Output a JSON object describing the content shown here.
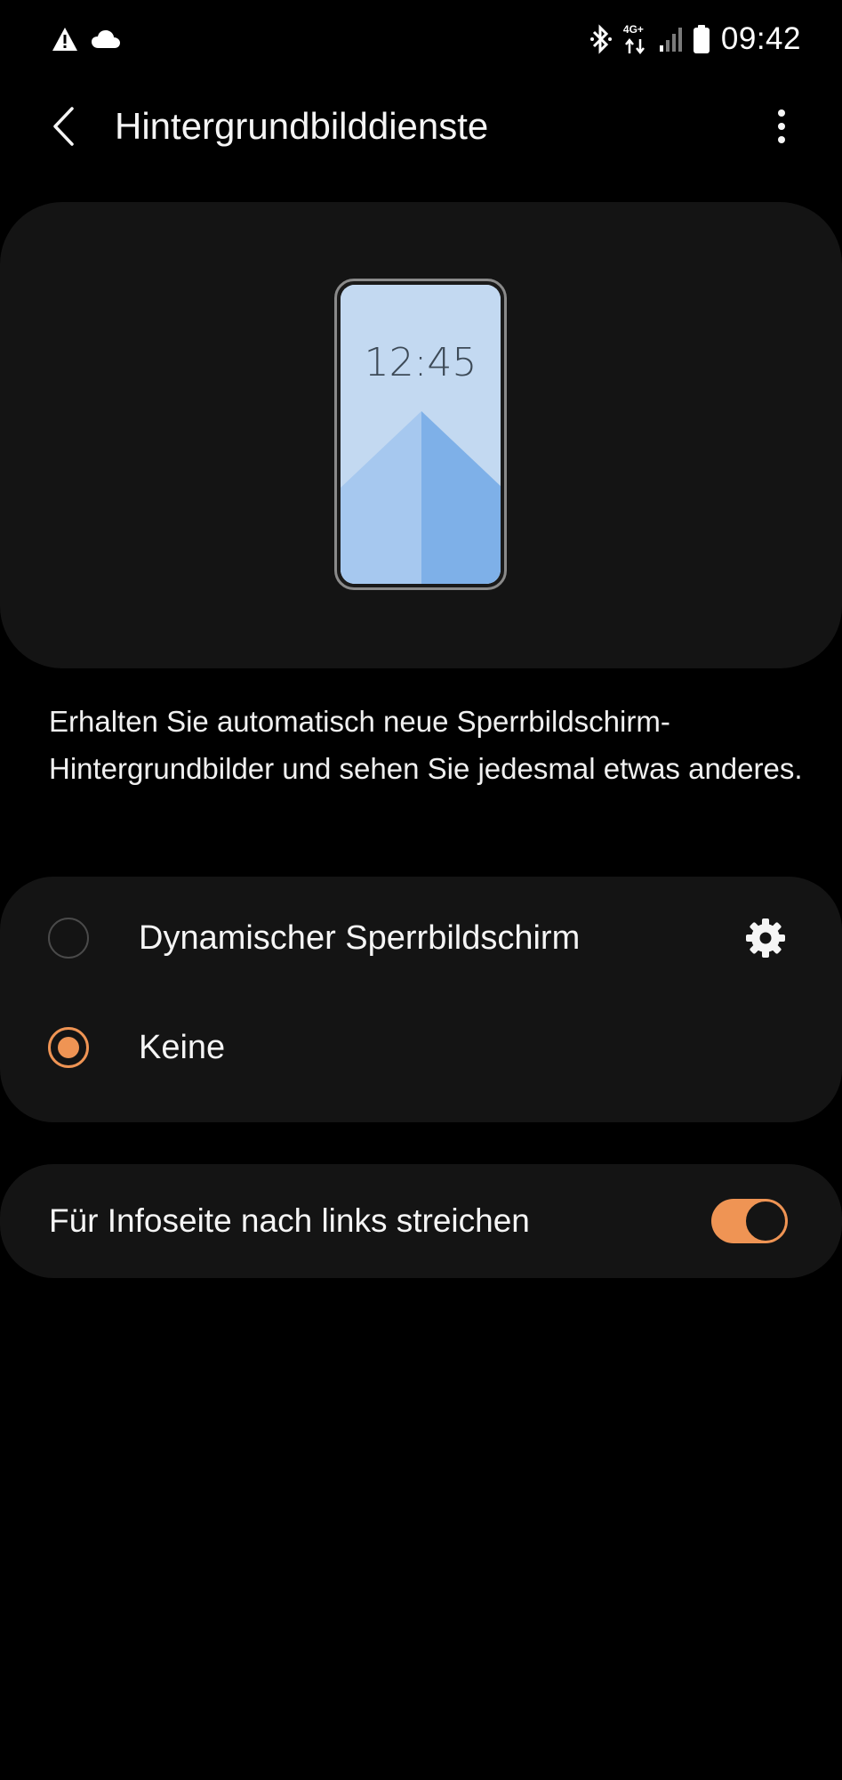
{
  "status_bar": {
    "time": "09:42",
    "network_label": "4G+",
    "left_icons": [
      "warning-icon",
      "cloud-icon"
    ],
    "right_icons": [
      "bluetooth-icon",
      "mobile-data-icon",
      "signal-icon",
      "battery-icon"
    ]
  },
  "header": {
    "title": "Hintergrundbilddienste",
    "back_icon": "chevron-left-icon",
    "more_icon": "more-vertical-icon"
  },
  "preview": {
    "clock": "12:45"
  },
  "description": "Erhalten Sie automatisch neue Sperrbildschirm-Hintergrundbilder und sehen Sie jedesmal etwas anderes.",
  "options": [
    {
      "label": "Dynamischer Sperrbildschirm",
      "selected": false,
      "has_settings": true,
      "settings_icon": "gear-icon"
    },
    {
      "label": "Keine",
      "selected": true,
      "has_settings": false
    }
  ],
  "swipe_setting": {
    "label": "Für Infoseite nach links streichen",
    "enabled": true
  },
  "colors": {
    "accent": "#ef9454",
    "background": "#000000",
    "card": "#141414",
    "text": "#f5f5f5"
  }
}
